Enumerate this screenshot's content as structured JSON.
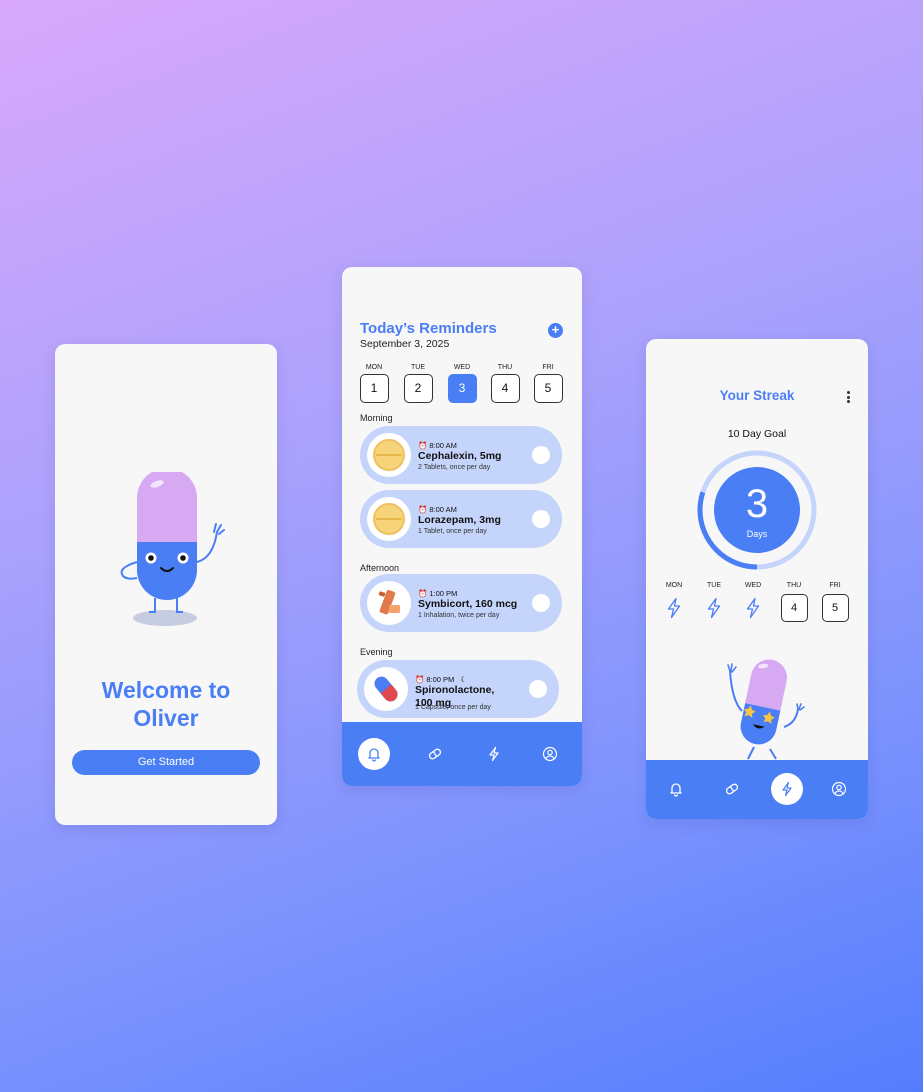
{
  "welcome": {
    "title_line1": "Welcome to",
    "title_line2": "Oliver",
    "cta_label": "Get Started"
  },
  "reminders": {
    "title": "Today’s Reminders",
    "date": "September 3, 2025",
    "add_icon": "plus-icon",
    "days": [
      {
        "name": "MON",
        "num": "1",
        "selected": false
      },
      {
        "name": "TUE",
        "num": "2",
        "selected": false
      },
      {
        "name": "WED",
        "num": "3",
        "selected": true
      },
      {
        "name": "THU",
        "num": "4",
        "selected": false
      },
      {
        "name": "FRI",
        "num": "5",
        "selected": false
      }
    ],
    "sections": [
      "Morning",
      "Afternoon",
      "Evening"
    ],
    "meds": [
      {
        "time": "8:00 AM",
        "name": "Cephalexin, 5mg",
        "dose": "2 Tablets, once per day",
        "icon": "yellow-tablet-icon"
      },
      {
        "time": "8:00 AM",
        "name": "Lorazepam, 3mg",
        "dose": "1 Tablet, once per day",
        "icon": "yellow-tablet-icon"
      },
      {
        "time": "1:00 PM",
        "name": "Symbicort, 160 mcg",
        "dose": "1 Inhalation, twice per day",
        "icon": "inhaler-icon"
      },
      {
        "time": "8:00 PM",
        "name_line1": "Spironolactone,",
        "name_line2": "100 mg",
        "dose": "1 Capsule, once per day",
        "icon": "capsule-icon"
      }
    ],
    "tabs": [
      "bell-icon",
      "pill-icon",
      "lightning-icon",
      "profile-icon"
    ],
    "active_tab": "bell-icon"
  },
  "streak": {
    "title": "Your Streak",
    "goal": "10 Day Goal",
    "count": "3",
    "count_label": "Days",
    "progress": 0.3,
    "days": [
      {
        "name": "MON",
        "done": true
      },
      {
        "name": "TUE",
        "done": true
      },
      {
        "name": "WED",
        "done": true
      },
      {
        "name": "THU",
        "num": "4",
        "done": false
      },
      {
        "name": "FRI",
        "num": "5",
        "done": false
      }
    ],
    "tabs": [
      "bell-icon",
      "pill-icon",
      "lightning-icon",
      "profile-icon"
    ],
    "active_tab": "lightning-icon"
  },
  "colors": {
    "accent": "#4a7ef5",
    "card": "#c5d4fb",
    "mascot_top": "#d7a9f3",
    "mascot_bottom": "#4a7ef5",
    "tablet": "#f7d37a",
    "star": "#f6c343"
  }
}
